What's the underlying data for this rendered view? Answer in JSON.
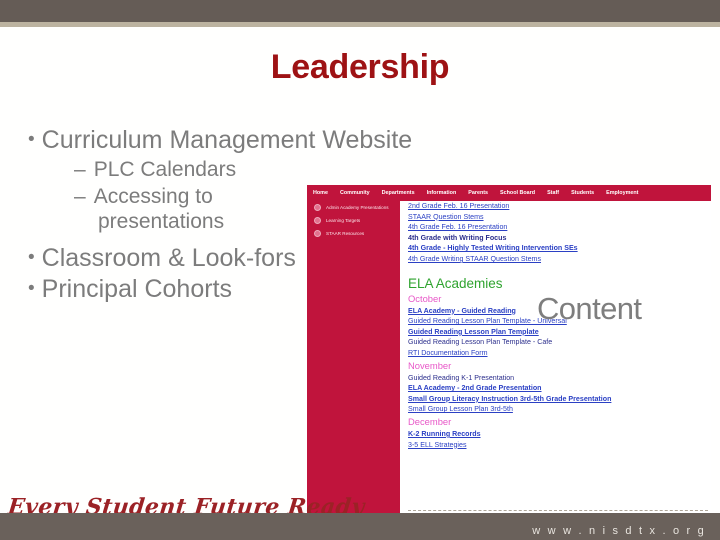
{
  "slide": {
    "title": "Leadership",
    "tagline": "Every Student Future Ready",
    "footer_url": "w w w . n i s d t x . o r g",
    "colors": {
      "title_red": "#9E1214",
      "body_gray": "#7C7C7C",
      "top_bar": "#655C56",
      "top_strip": "#BCB3A0",
      "bottom_bar": "#6A615B",
      "site_crimson": "#C0143C",
      "link_blue": "#2B40C4",
      "section_green": "#2FA32F",
      "month_magenta": "#E858C8",
      "overlay_gray": "#7E7E7E"
    }
  },
  "bullets": [
    {
      "level": 1,
      "bullet": "•",
      "text": "Curriculum Management Website"
    },
    {
      "level": 2,
      "bullet": "–",
      "text": "PLC Calendars"
    },
    {
      "level": 2,
      "bullet": "–",
      "text": "Accessing to presentations"
    },
    {
      "level": 1,
      "bullet": "•",
      "text": "Classroom  & Look-fors"
    },
    {
      "level": 1,
      "bullet": "•",
      "text": "Principal Cohorts"
    }
  ],
  "overlay": {
    "word": "Content"
  },
  "website_screenshot": {
    "nav_items": [
      "Home",
      "Community",
      "Departments",
      "Information",
      "Parents",
      "School Board",
      "Staff",
      "Students",
      "Employment"
    ],
    "sidebar_items": [
      "Admin Academy Presentations",
      "Learning Targets",
      "STAAR Resources"
    ],
    "top_links": [
      {
        "text": "2nd Grade Feb. 16 Presentation",
        "underlined": true,
        "bold": false
      },
      {
        "text": "STAAR Question Stems",
        "underlined": true,
        "bold": false
      },
      {
        "text": "4th Grade Feb. 16 Presentation",
        "underlined": true,
        "bold": false
      },
      {
        "text": "4th Grade with Writing Focus",
        "underlined": false,
        "bold": true
      },
      {
        "text": "4th Grade - Highly Tested Writing Intervention SEs",
        "underlined": true,
        "bold": true
      },
      {
        "text": "4th Grade Writing STAAR Question Stems",
        "underlined": true,
        "bold": false
      }
    ],
    "section_heading": "ELA Academies",
    "months": [
      {
        "name": "October",
        "links": [
          {
            "text": "ELA Academy - Guided Reading",
            "underlined": true,
            "bold": true
          },
          {
            "text": "Guided Reading Lesson Plan Template - Universal",
            "underlined": true,
            "bold": false
          },
          {
            "text": "Guided Reading Lesson Plan Template",
            "underlined": true,
            "bold": true
          },
          {
            "text": "Guided Reading Lesson Plan Template - Cafe",
            "underlined": false,
            "bold": false
          },
          {
            "text": "RTI Documentation Form",
            "underlined": true,
            "bold": false
          }
        ]
      },
      {
        "name": "November",
        "links": [
          {
            "text": "Guided Reading K-1 Presentation",
            "underlined": false,
            "bold": false
          },
          {
            "text": "ELA Academy - 2nd Grade Presentation",
            "underlined": true,
            "bold": true
          },
          {
            "text": "Small Group Literacy Instruction 3rd-5th Grade Presentation",
            "underlined": true,
            "bold": true
          },
          {
            "text": "Small Group Lesson Plan 3rd-5th",
            "underlined": true,
            "bold": false
          }
        ]
      },
      {
        "name": "December",
        "links": [
          {
            "text": "K-2 Running Records",
            "underlined": true,
            "bold": true
          },
          {
            "text": "3-5 ELL Strategies",
            "underlined": true,
            "bold": false
          }
        ]
      }
    ]
  }
}
